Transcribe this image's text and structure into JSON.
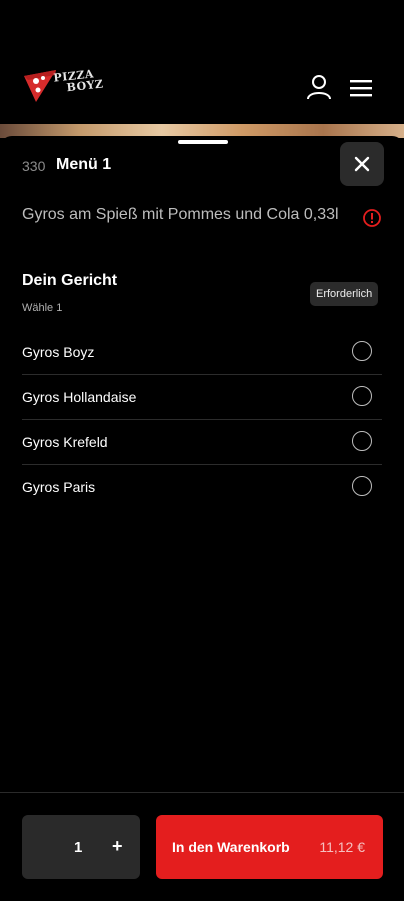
{
  "header": {
    "logo_line1": "PIZZA",
    "logo_line2": "BOYZ",
    "icons": {
      "account": "user-icon",
      "menu": "hamburger-icon"
    }
  },
  "sheet": {
    "item_number": "330",
    "item_title": "Menü 1",
    "description": "Gyros am Spieß mit Pommes und Cola 0,33l",
    "close_icon": "close-icon",
    "info_icon": "info-icon"
  },
  "choice_group": {
    "title": "Dein Gericht",
    "subtitle": "Wähle 1",
    "badge": "Erforderlich",
    "options": [
      {
        "label": "Gyros Boyz",
        "selected": false
      },
      {
        "label": "Gyros Hollandaise",
        "selected": false
      },
      {
        "label": "Gyros Krefeld",
        "selected": false
      },
      {
        "label": "Gyros Paris",
        "selected": false
      }
    ]
  },
  "footer": {
    "quantity": "1",
    "plus_label": "+",
    "add_to_cart_label": "In den Warenkorb",
    "price": "11,12 €"
  },
  "colors": {
    "background": "#000000",
    "accent": "#e41e1e",
    "surface": "#2a2a2a",
    "info": "#e41e1e"
  }
}
